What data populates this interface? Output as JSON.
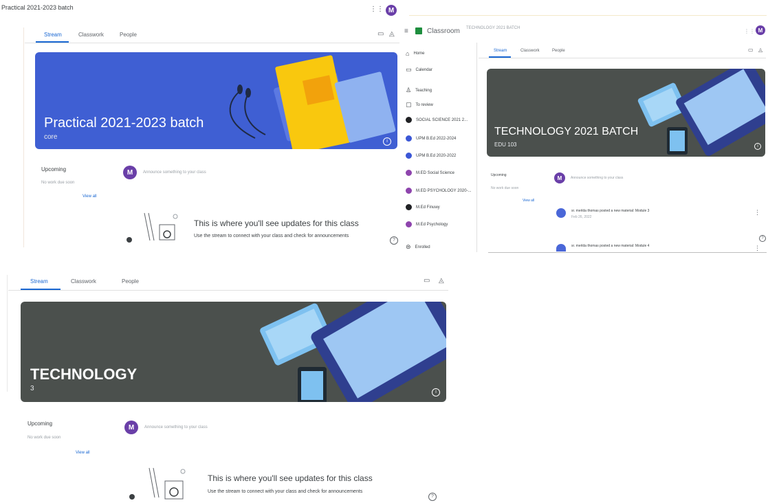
{
  "panel1": {
    "window_title": "Practical 2021-2023 batch",
    "tabs": [
      "Stream",
      "Classwork",
      "People"
    ],
    "banner_title": "Practical 2021-2023 batch",
    "banner_subtitle": "core",
    "upcoming_label": "Upcoming",
    "upcoming_text": "No work due soon",
    "view_all": "View all",
    "announce_placeholder": "Announce something to your class",
    "empty_title": "This is where you'll see updates for this class",
    "empty_sub": "Use the stream to connect with your class and check for announcements",
    "avatar_letter": "M"
  },
  "panel2": {
    "app_name": "Classroom",
    "breadcrumb": "TECHNOLOGY 2021 BATCH",
    "tabs": [
      "Stream",
      "Classwork",
      "People"
    ],
    "sidebar": [
      {
        "label": "Home"
      },
      {
        "label": "Calendar"
      },
      {
        "label": "Teaching"
      },
      {
        "label": "To review"
      },
      {
        "label": "SOCIAL SCIENCE 2021 2..."
      },
      {
        "label": "UPM B.Ed 2022-2024"
      },
      {
        "label": "UPM B.Ed 2020-2022"
      },
      {
        "label": "M.ED Social Science"
      },
      {
        "label": "M.ED PSYCHOLOGY 2020-..."
      },
      {
        "label": "M.Ed Finuwy"
      },
      {
        "label": "M.Ed Psychology"
      },
      {
        "label": "Enrolled"
      }
    ],
    "banner_title": "TECHNOLOGY 2021 BATCH",
    "banner_subtitle": "EDU 103",
    "upcoming_label": "Upcoming",
    "upcoming_text": "No work due soon",
    "view_all": "View all",
    "announce_placeholder": "Announce something to your class",
    "posts": [
      {
        "text": "sr. merlda thomas posted a new material: Module 3",
        "date": "Feb 26, 2022"
      },
      {
        "text": "sr. merlda thomas posted a new material: Module 4",
        "date": ""
      }
    ],
    "avatar_letter": "M"
  },
  "panel3": {
    "tabs": [
      "Stream",
      "Classwork",
      "People"
    ],
    "banner_title": "TECHNOLOGY",
    "banner_subtitle": "3",
    "upcoming_label": "Upcoming",
    "upcoming_text": "No work due soon",
    "view_all": "View all",
    "announce_placeholder": "Announce something to your class",
    "empty_title": "This is where you'll see updates for this class",
    "empty_sub": "Use the stream to connect with your class and check for announcements",
    "avatar_letter": "M"
  },
  "colors": {
    "blue_banner": "#3f5fd3",
    "gray_banner": "#4b504d",
    "accent": "#1967d2",
    "avatar": "#6a3fa8"
  }
}
